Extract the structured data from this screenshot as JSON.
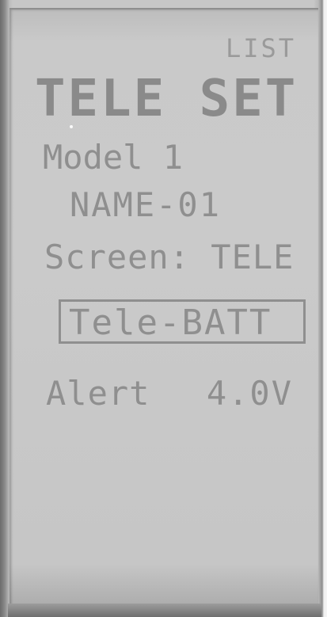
{
  "header": {
    "list_label": "LIST",
    "title": "TELE SET"
  },
  "model": {
    "label": "Model 1",
    "name": "NAME-01"
  },
  "screen": {
    "text": "Screen: TELE"
  },
  "sensor": {
    "selected": "Tele-BATT"
  },
  "alert": {
    "label": "Alert",
    "value": "4.0V"
  },
  "colors": {
    "lcd_background": "#c9c9c9",
    "lcd_text": "#8f8f8f"
  }
}
